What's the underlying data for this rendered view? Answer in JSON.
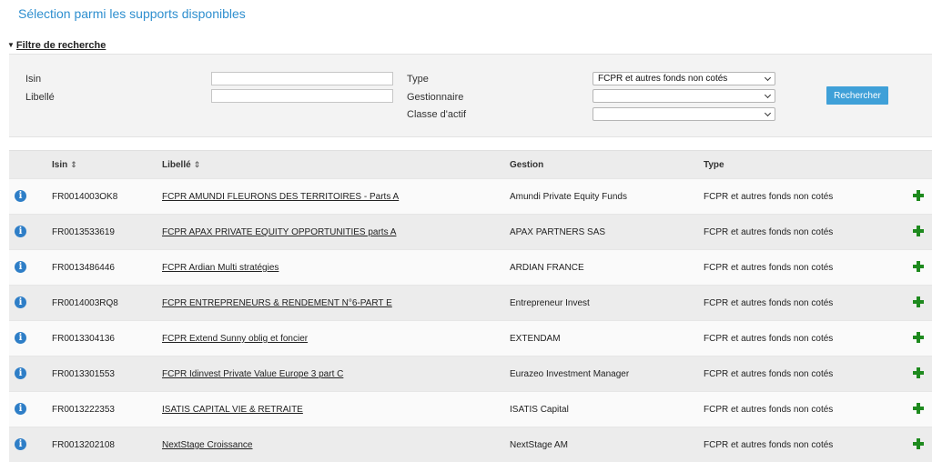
{
  "page": {
    "title": "Sélection parmi les supports disponibles"
  },
  "filter": {
    "toggle_label": "Filtre de recherche",
    "isin_label": "Isin",
    "isin_value": "",
    "libelle_label": "Libellé",
    "libelle_value": "",
    "type_label": "Type",
    "type_value": "FCPR et autres fonds non cotés",
    "gestionnaire_label": "Gestionnaire",
    "gestionnaire_value": "",
    "classe_label": "Classe d'actif",
    "classe_value": "",
    "search_button": "Rechercher"
  },
  "table": {
    "headers": {
      "isin": "Isin",
      "libelle": "Libellé",
      "gestion": "Gestion",
      "type": "Type"
    },
    "sort_glyph": "⇕",
    "rows": [
      {
        "isin": "FR0014003OK8",
        "libelle": "FCPR AMUNDI FLEURONS DES TERRITOIRES - Parts A",
        "gestion": "Amundi Private Equity Funds",
        "type": "FCPR et autres fonds non cotés"
      },
      {
        "isin": "FR0013533619",
        "libelle": "FCPR APAX PRIVATE EQUITY OPPORTUNITIES parts A",
        "gestion": "APAX PARTNERS SAS",
        "type": "FCPR et autres fonds non cotés"
      },
      {
        "isin": "FR0013486446",
        "libelle": "FCPR Ardian Multi stratégies",
        "gestion": "ARDIAN FRANCE",
        "type": "FCPR et autres fonds non cotés"
      },
      {
        "isin": "FR0014003RQ8",
        "libelle": "FCPR ENTREPRENEURS & RENDEMENT N°6-PART E",
        "gestion": "Entrepreneur Invest",
        "type": "FCPR et autres fonds non cotés"
      },
      {
        "isin": "FR0013304136",
        "libelle": "FCPR Extend Sunny oblig et foncier",
        "gestion": "EXTENDAM",
        "type": "FCPR et autres fonds non cotés"
      },
      {
        "isin": "FR0013301553",
        "libelle": "FCPR Idinvest Private Value Europe 3 part C",
        "gestion": "Eurazeo Investment Manager",
        "type": "FCPR et autres fonds non cotés"
      },
      {
        "isin": "FR0013222353",
        "libelle": "ISATIS CAPITAL VIE & RETRAITE",
        "gestion": "ISATIS Capital",
        "type": "FCPR et autres fonds non cotés"
      },
      {
        "isin": "FR0013202108",
        "libelle": "NextStage Croissance",
        "gestion": "NextStage AM",
        "type": "FCPR et autres fonds non cotés"
      }
    ]
  },
  "icons": {
    "info": "info-icon",
    "add": "plus-icon",
    "info_glyph": "i"
  },
  "colors": {
    "accent": "#2f8fcf",
    "button": "#3fa0d8",
    "info": "#2e7ec7",
    "add": "#1e8a1e"
  }
}
